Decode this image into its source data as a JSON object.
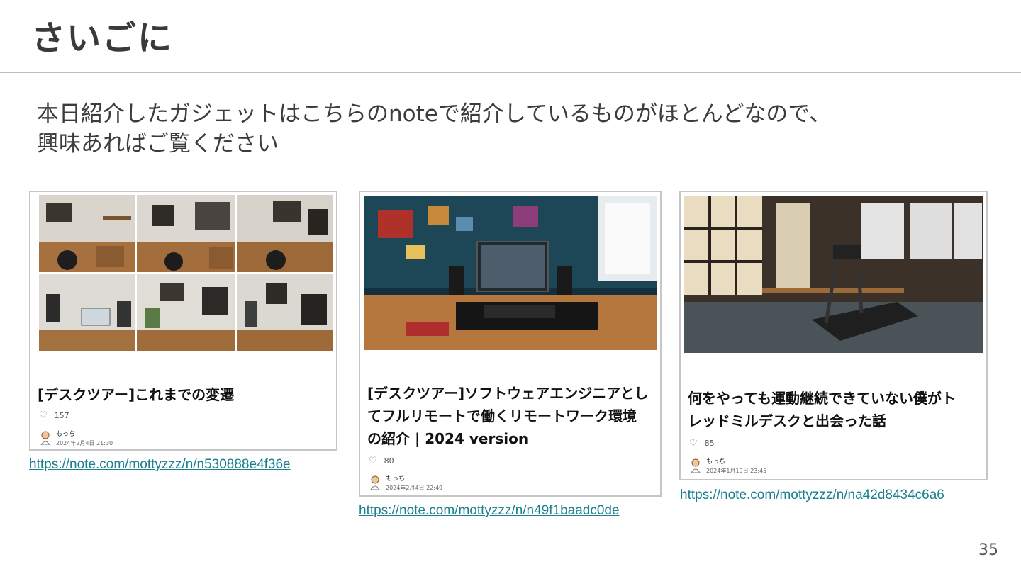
{
  "slide": {
    "title": "さいごに",
    "lead_line1": "本日紹介したガジェットはこちらのnoteで紹介しているものがほとんどなので、",
    "lead_line2": "興味あればご覧ください",
    "page_number": "35"
  },
  "cards": [
    {
      "title": "[デスクツアー]これまでの変遷",
      "likes": "157",
      "author": "もっち",
      "date": "2024年2月4日 21:30",
      "url": "https://note.com/mottyzzz/n/n530888e4f36e"
    },
    {
      "title": "[デスクツアー]ソフトウェアエンジニアとし\nてフルリモートで働くリモートワーク環境\nの紹介 | 2024 version",
      "likes": "80",
      "author": "もっち",
      "date": "2024年2月4日 22:49",
      "url": "https://note.com/mottyzzz/n/n49f1baadc0de"
    },
    {
      "title": "何をやっても運動継続できていない僕がト\nレッドミルデスクと出会った話",
      "likes": "85",
      "author": "もっち",
      "date": "2024年1月19日 23:45",
      "url": "https://note.com/mottyzzz/n/na42d8434c6a6"
    }
  ],
  "colors": {
    "link": "#1a7f8e",
    "rule": "#bdbdbd"
  }
}
